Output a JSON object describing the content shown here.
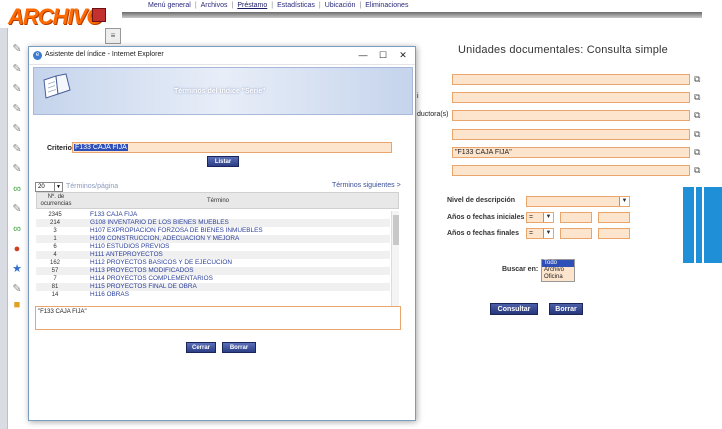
{
  "app": {
    "logo_text": "ARCHIVO",
    "menu": [
      {
        "label": "Menú general"
      },
      {
        "label": "Archivos"
      },
      {
        "label": "Préstamo"
      },
      {
        "label": "Estadísticas"
      },
      {
        "label": "Ubicación"
      },
      {
        "label": "Eliminaciones"
      }
    ],
    "page_heading": "Unidades documentales: Consulta simple",
    "partial_label_1": "i",
    "partial_label_2": "ductora(s)",
    "fields": [
      {
        "value": ""
      },
      {
        "value": ""
      },
      {
        "value": ""
      },
      {
        "value": ""
      },
      {
        "value": "\"F133 CAJA FIJA\""
      },
      {
        "value": ""
      }
    ],
    "nivel_label": "Nivel de descripción",
    "anios_iniciales_label": "Años o fechas iniciales",
    "anios_finales_label": "Años o fechas finales",
    "operator_value": "=",
    "buscar_label": "Buscar en:",
    "buscar_options": [
      {
        "label": "Todo",
        "selected": true
      },
      {
        "label": "Archivo",
        "selected": false
      },
      {
        "label": "Oficina",
        "selected": false
      }
    ],
    "consultar_label": "Consultar",
    "borrar_label": "Borrar"
  },
  "dialog": {
    "window_title": "Asistente del índice - Internet Explorer",
    "minimize": "—",
    "maximize": "☐",
    "close": "✕",
    "header_title": "Términos del índice \"Serie\"",
    "criterio_label": "Criterio",
    "criterio_value": "F133 CAJA FIJA",
    "listar_label": "Listar",
    "per_page_value": "20",
    "per_page_label": "Términos/página",
    "next_label": "Términos siguientes >",
    "col_num": "Nº. de ocurrencias",
    "col_term": "Término",
    "rows": [
      {
        "n": "2345",
        "t": "F133 CAJA FIJA"
      },
      {
        "n": "214",
        "t": "G108 INVENTARIO DE LOS BIENES MUEBLES"
      },
      {
        "n": "3",
        "t": "H107 EXPROPIACION FORZOSA DE BIENES INMUEBLES"
      },
      {
        "n": "1",
        "t": "H109 CONSTRUCCION, ADECUACION Y MEJORA"
      },
      {
        "n": "6",
        "t": "H110 ESTUDIOS PREVIOS"
      },
      {
        "n": "4",
        "t": "H111 ANTEPROYECTOS"
      },
      {
        "n": "162",
        "t": "H112 PROYECTOS BASICOS Y DE EJECUCION"
      },
      {
        "n": "57",
        "t": "H113 PROYECTOS MODIFICADOS"
      },
      {
        "n": "7",
        "t": "H114 PROYECTOS COMPLEMENTARIOS"
      },
      {
        "n": "81",
        "t": "H115 PROYECTOS FINAL DE OBRA"
      },
      {
        "n": "14",
        "t": "H116 OBRAS"
      }
    ],
    "result_value": "\"F133 CAJA FIJA\"",
    "cerrar_label": "Cerrar",
    "borrar_label": "Borrar"
  },
  "colors": {
    "field_bg": "#fde4cc",
    "field_border": "#e9a56b",
    "button_blue": "#2d3f86",
    "link_blue": "#2a3f9a",
    "logo_orange": "#ff6a00"
  }
}
